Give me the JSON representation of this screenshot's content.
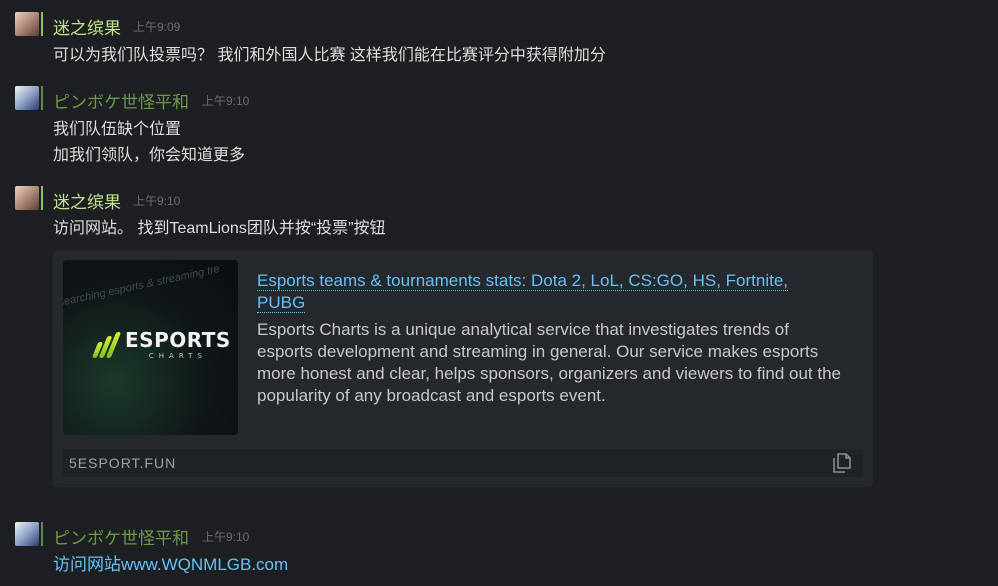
{
  "messages": [
    {
      "author": "迷之缤果",
      "time": "上午9:09",
      "avatar_icon": "anime-girl-avatar",
      "lines": [
        "可以为我们队投票吗？ 我们和外国人比赛 这样我们能在比赛评分中获得附加分"
      ]
    },
    {
      "author": "ピンボケ世怪平和",
      "time": "上午9:10",
      "avatar_icon": "anime-character-avatar",
      "lines": [
        "我们队伍缺个位置",
        "加我们领队，你会知道更多"
      ]
    },
    {
      "author": "迷之缤果",
      "time": "上午9:10",
      "avatar_icon": "anime-girl-avatar",
      "lines": [
        "访问网站。 找到TeamLions团队并按“投票”按钮"
      ],
      "embed": {
        "title": "Esports teams & tournaments stats: Dota 2, LoL, CS:GO, HS, Fortnite, PUBG",
        "description": "Esports Charts is a unique analytical service that investigates trends of esports development and streaming in general. Our service makes esports more honest and clear, helps sponsors, organizers and viewers to find out the popularity of any broadcast and esports event.",
        "domain": "5ESPORT.FUN",
        "thumbnail": {
          "logo_word": "ESPORTS",
          "logo_sub": "CHARTS",
          "bg_text": "searching esports & streaming tre"
        },
        "copy_icon": "copy-icon"
      }
    },
    {
      "author": "ピンボケ世怪平和",
      "time": "上午9:10",
      "avatar_icon": "anime-character-avatar",
      "link_prefix": "访问网站",
      "link_url": "www.WQNMLGB.com"
    }
  ],
  "colors": {
    "background": "#1e1f23",
    "name_online": "#bde28b",
    "name_ingame": "#6a9b46",
    "link": "#66c0f4",
    "timestamp": "#6b6e72"
  }
}
